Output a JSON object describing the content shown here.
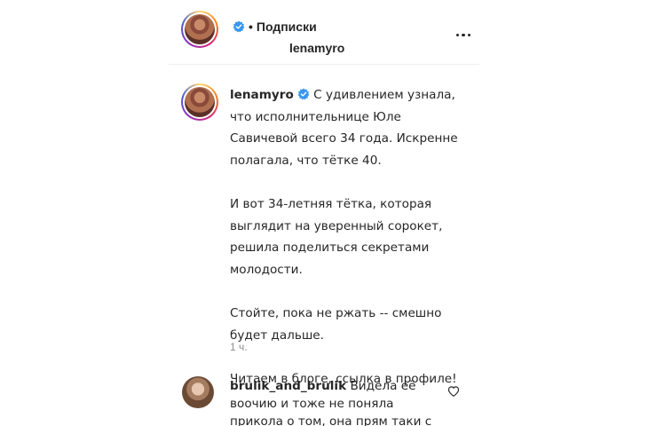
{
  "header": {
    "username": "lenamyro",
    "separator": "•",
    "follow_label": "Подписки",
    "more_icon": "more-horizontal-icon",
    "verified_icon": "verified-badge-icon"
  },
  "caption": {
    "username": "lenamyro",
    "paragraphs": [
      "С удивлением узнала, что исполнительнице Юле Савичевой всего 34 года. Искренне полагала, что тётке 40.",
      "И вот 34-летняя тётка, которая выглядит на уверенный сорокет, решила поделиться секретами молодости.",
      "Стойте, пока не ржать -- смешно будет дальше.",
      "Читаем в блоге, ссылка в профиле!"
    ],
    "timestamp": "1 ч."
  },
  "comment": {
    "username": "brulik_and_brulik",
    "text": "Видела её воочию и тоже не поняла прикола о том, она прям таки с",
    "like_icon": "heart-icon"
  },
  "colors": {
    "verified": "#3897f0",
    "text": "#262626",
    "muted": "#8e8e8e",
    "divider": "#efefef"
  }
}
